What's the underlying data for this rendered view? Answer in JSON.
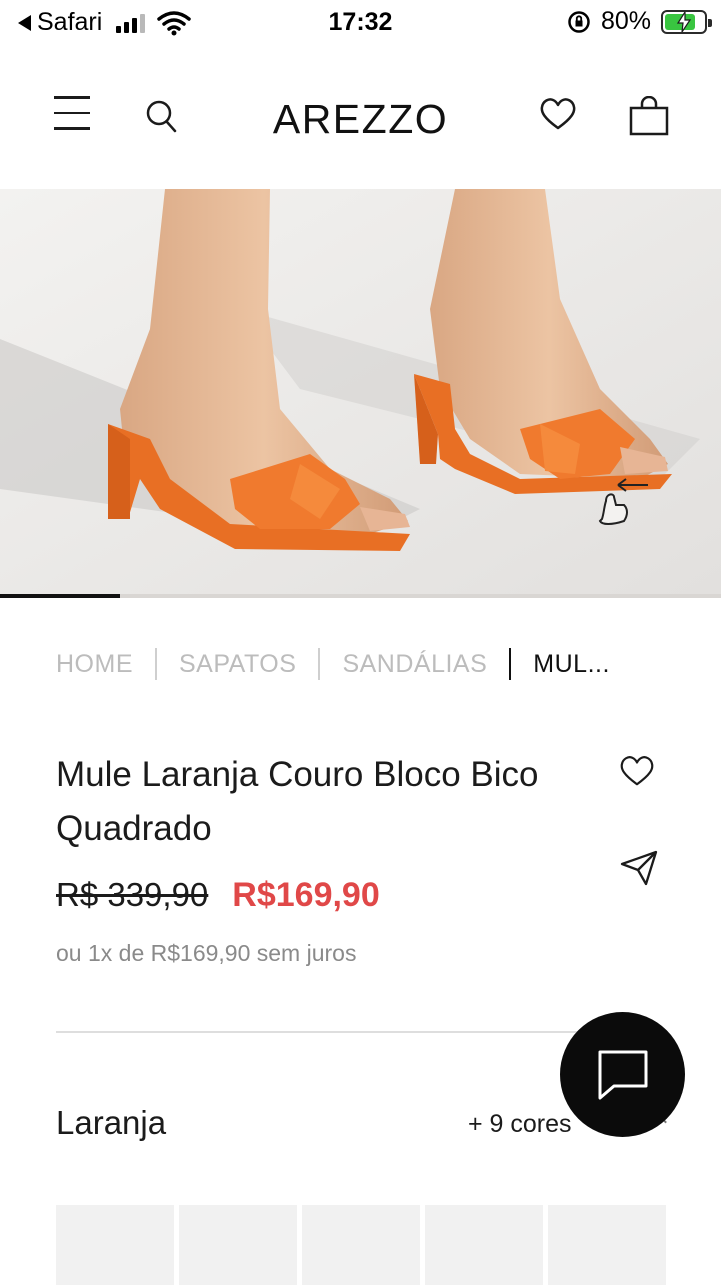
{
  "status_bar": {
    "back_app": "Safari",
    "time": "17:32",
    "battery_percent": "80%",
    "battery_level": 0.8,
    "battery_color": "#39c540"
  },
  "header": {
    "brand": "AREZZO",
    "icons": [
      "menu-icon",
      "search-icon",
      "heart-icon",
      "shopping-bag-icon"
    ]
  },
  "gallery": {
    "image_alt": "Orange block-heel mules worn on feet",
    "progress": 0.167,
    "shoe_color": "#f07a2e"
  },
  "breadcrumb": {
    "items": [
      "HOME",
      "SAPATOS",
      "SANDÁLIAS",
      "MUL..."
    ]
  },
  "product": {
    "title": "Mule Laranja Couro Bloco Bico Quadrado",
    "price_old": "R$ 339,90",
    "price_new": "R$169,90",
    "installment": "ou 1x de R$169,90 sem juros",
    "price_color": "#e04848"
  },
  "colors": {
    "selected": "Laranja",
    "more": "+ 9 cores"
  },
  "chat": {
    "icon": "chat-icon"
  }
}
